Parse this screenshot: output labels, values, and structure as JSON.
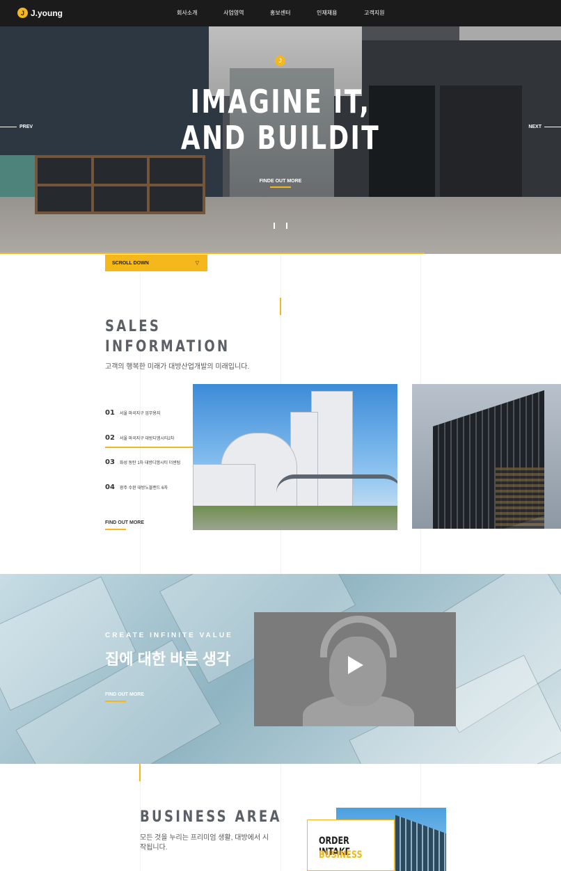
{
  "header": {
    "logo_text": "J.young",
    "logo_mark": "J",
    "nav": [
      {
        "label": "회사소개"
      },
      {
        "label": "사업영역"
      },
      {
        "label": "홍보센터"
      },
      {
        "label": "인재채용"
      },
      {
        "label": "고객지원"
      }
    ]
  },
  "hero": {
    "badge": "J",
    "title_line1": "IMAGINE IT,",
    "title_line2": "AND BUILDIT",
    "cta": "FINDE OUT MORE",
    "prev": "PREV",
    "next": "NEXT"
  },
  "scroll": {
    "label": "SCROLL DOWN",
    "icon": "chevron-down-icon"
  },
  "sales": {
    "title_line1": "SALES",
    "title_line2": "INFORMATION",
    "subtitle": "고객의 행복한 미래가 대방산업개발의 미래입니다.",
    "items": [
      {
        "num": "01",
        "text": "서울 마곡지구 업무용지"
      },
      {
        "num": "02",
        "text": "서울 마곡지구 대방디엠시티2차"
      },
      {
        "num": "03",
        "text": "화성 동탄 1차 대방디엠시티 더센텀"
      },
      {
        "num": "04",
        "text": "광주 수완 대방노블랜드 6차"
      }
    ],
    "active_index": 2,
    "cta": "FIND OUT MORE"
  },
  "video_section": {
    "label": "CREATE INFINITE VALUE",
    "title": "집에 대한 바른 생각",
    "cta": "FIND OUT MORE",
    "play_icon": "play-icon"
  },
  "business": {
    "title": "BUSINESS AREA",
    "subtitle": "모든 것을 누리는 프리미엄 생활, 대방에서 시작됩니다.",
    "card_line1": "ORDER INTAKE",
    "card_line2": "BUSINESS"
  },
  "colors": {
    "accent": "#f5b81c",
    "header_bg": "#1b1b1b",
    "title_gray": "#5b5f66"
  }
}
